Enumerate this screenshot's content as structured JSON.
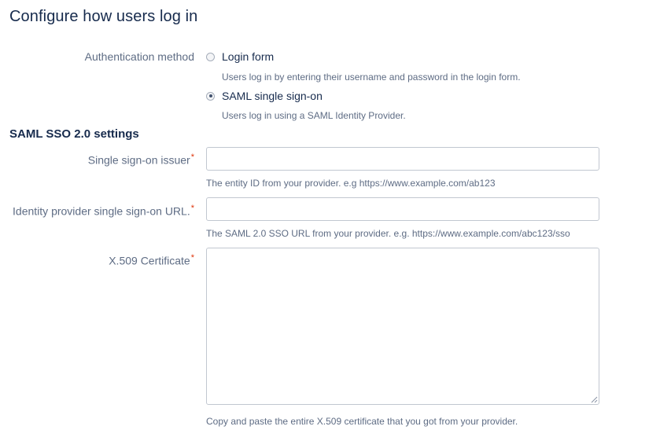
{
  "page_title": "Configure how users log in",
  "auth": {
    "label": "Authentication method",
    "options": [
      {
        "label": "Login form",
        "help": "Users log in by entering their username and password in the login form.",
        "checked": false
      },
      {
        "label": "SAML single sign-on",
        "help": "Users log in using a SAML Identity Provider.",
        "checked": true
      }
    ]
  },
  "saml": {
    "section_title": "SAML SSO 2.0 settings",
    "issuer": {
      "label": "Single sign-on issuer",
      "required_mark": "*",
      "value": "",
      "help": "The entity ID from your provider. e.g https://www.example.com/ab123"
    },
    "sso_url": {
      "label": "Identity provider single sign-on URL.",
      "required_mark": "*",
      "value": "",
      "help": "The SAML 2.0 SSO URL from your provider. e.g. https://www.example.com/abc123/sso"
    },
    "certificate": {
      "label": "X.509 Certificate",
      "required_mark": "*",
      "value": "",
      "help": "Copy and paste the entire X.509 certificate that you got from your provider."
    }
  },
  "colors": {
    "required": "#de350b",
    "label": "#5e6c84",
    "text": "#172b4d",
    "input_border": "#c1c7d0"
  }
}
